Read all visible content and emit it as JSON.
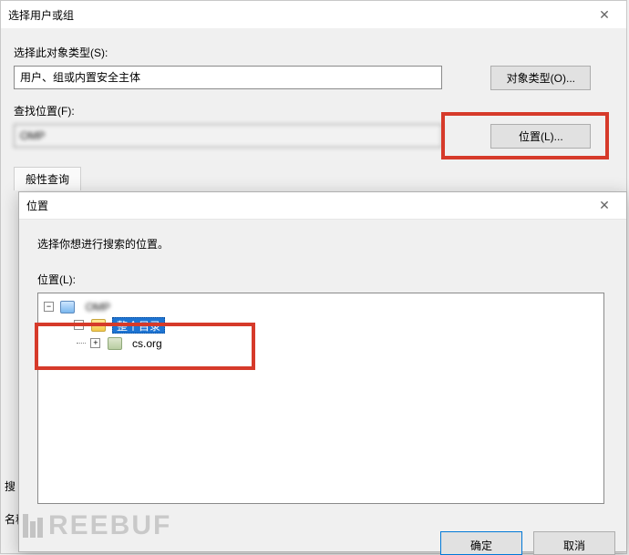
{
  "parent": {
    "title": "选择用户或组",
    "close_x": "✕",
    "objtype_label": "选择此对象类型(S):",
    "objtype_value": "用户、组或内置安全主体",
    "objtype_btn": "对象类型(O)...",
    "location_label": "查找位置(F):",
    "location_value": "              OMP",
    "location_btn": "位置(L)...",
    "tab_label": "般性查询",
    "side1": "搜",
    "side2": "名称"
  },
  "loc": {
    "title": "位置",
    "close_x": "✕",
    "desc": "选择你想进行搜索的位置。",
    "tree_label": "位置(L):",
    "tree": {
      "root_label": "                 OMP",
      "dir_label": "整个目录",
      "domain_label": "cs.org"
    },
    "ok_btn": "确定",
    "cancel_btn": "取消"
  },
  "watermark": "REEBUF"
}
